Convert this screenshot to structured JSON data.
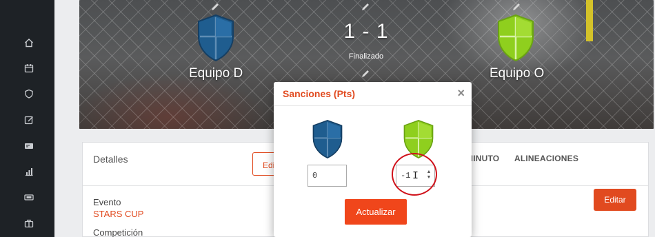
{
  "sidebar": {
    "icons": [
      "home-icon",
      "calendar-icon",
      "shield-icon",
      "edit-icon",
      "id-card-icon",
      "bar-chart-icon",
      "ticket-icon",
      "briefcase-icon"
    ]
  },
  "match": {
    "home_team": "Equipo D",
    "away_team": "Equipo O",
    "score": "1 - 1",
    "status": "Finalizado",
    "home_color": "#1f5d8f",
    "away_color": "#8fcf1e"
  },
  "details": {
    "title": "Detalles",
    "edit_left_label": "Edi",
    "tab_minuto": "MINUTO",
    "tab_alineaciones": "ALINEACIONES",
    "edit_right_label": "Editar",
    "event_label": "Evento",
    "event_value": "STARS CUP",
    "competition_label": "Competición"
  },
  "modal": {
    "title": "Sanciones (Pts)",
    "close_symbol": "×",
    "home_points": "0",
    "away_points": "-1",
    "update_label": "Actualizar"
  },
  "colors": {
    "accent": "#e14a1f",
    "annotation": "#d0121b"
  }
}
